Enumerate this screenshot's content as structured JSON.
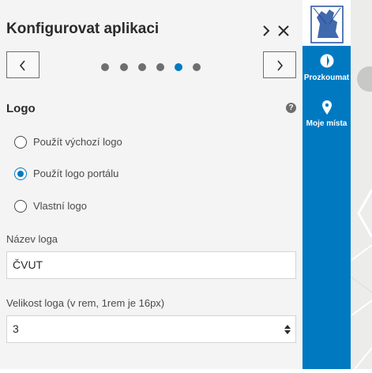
{
  "panel": {
    "title": "Konfigurovat aplikaci",
    "step_count": 6,
    "active_step": 5
  },
  "section": {
    "title": "Logo",
    "options": [
      {
        "label": "Použít výchozí logo",
        "checked": false
      },
      {
        "label": "Použít logo portálu",
        "checked": true
      },
      {
        "label": "Vlastní logo",
        "checked": false
      }
    ]
  },
  "fields": {
    "logo_name_label": "Název loga",
    "logo_name_value": "ČVUT",
    "logo_size_label": "Velikost loga (v rem, 1rem je 16px)",
    "logo_size_value": "3"
  },
  "sidebar": {
    "explore_label": "Prozkoumat",
    "places_label": "Moje místa"
  },
  "colors": {
    "accent": "#0079c1",
    "panel_bg": "#f4f4f4"
  }
}
